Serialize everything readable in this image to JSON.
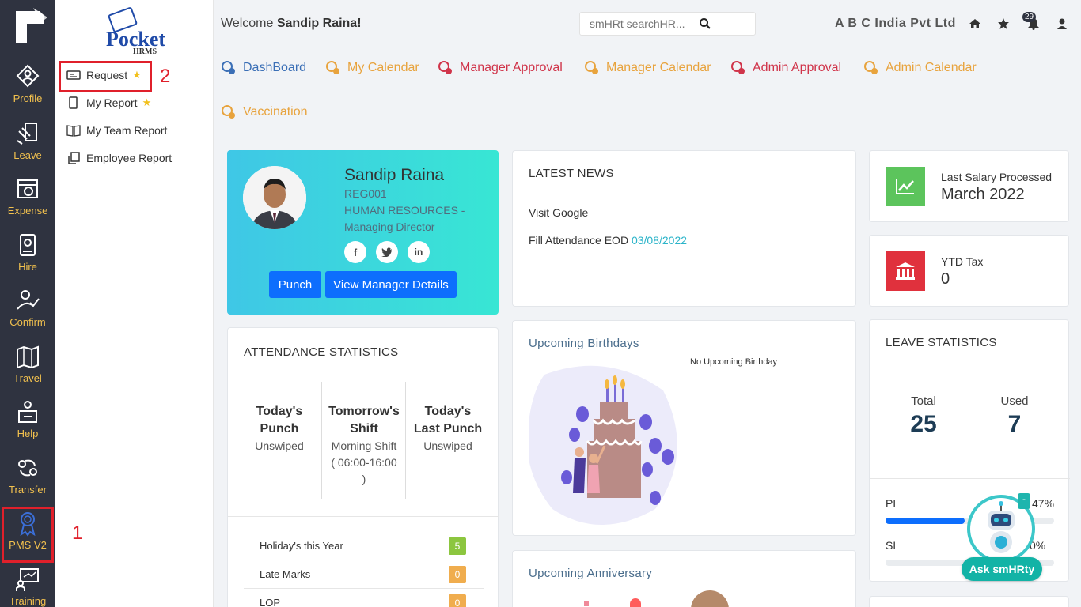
{
  "rail": {
    "items": [
      {
        "label": "Profile"
      },
      {
        "label": "Leave"
      },
      {
        "label": "Expense"
      },
      {
        "label": "Hire"
      },
      {
        "label": "Confirm"
      },
      {
        "label": "Travel"
      },
      {
        "label": "Help"
      },
      {
        "label": "Transfer"
      },
      {
        "label": "PMS V2"
      },
      {
        "label": "Training"
      }
    ],
    "accent_color": "#f2c14e"
  },
  "brand": {
    "logo_text": "Pocket",
    "logo_sub": "HRMS"
  },
  "submenu": {
    "items": [
      {
        "label": "Request",
        "starred": true
      },
      {
        "label": "My Report",
        "starred": true
      },
      {
        "label": "My Team Report",
        "starred": false
      },
      {
        "label": "Employee Report",
        "starred": false
      }
    ]
  },
  "annotations": {
    "one": "1",
    "two": "2"
  },
  "header": {
    "welcome_prefix": "Welcome",
    "user_name": "Sandip Raina!",
    "search_placeholder": "smHRt searchHR...",
    "company": "A B C India Pvt Ltd",
    "notification_count": "29"
  },
  "tabs": [
    {
      "label": "DashBoard",
      "color": "#3b6fb6"
    },
    {
      "label": "My Calendar",
      "color": "#e8a33d"
    },
    {
      "label": "Manager Approval",
      "color": "#d0344a"
    },
    {
      "label": "Manager Calendar",
      "color": "#e8a33d"
    },
    {
      "label": "Admin Approval",
      "color": "#d0344a"
    },
    {
      "label": "Admin Calendar",
      "color": "#e8a33d"
    },
    {
      "label": "Vaccination",
      "color": "#e8a33d"
    }
  ],
  "profile": {
    "name": "Sandip Raina",
    "code": "REG001",
    "department": "HUMAN RESOURCES -",
    "designation": "Managing Director",
    "punch_label": "Punch",
    "manager_label": "View Manager Details"
  },
  "news": {
    "title": "LATEST NEWS",
    "item1": "Visit Google",
    "item2_text": "Fill Attendance EOD",
    "item2_date": "03/08/2022"
  },
  "salary": {
    "label": "Last Salary Processed",
    "value": "March 2022"
  },
  "tax": {
    "label": "YTD Tax",
    "value": "0"
  },
  "attendance": {
    "title": "ATTENDANCE STATISTICS",
    "col1_h1": "Today's",
    "col1_h2": "Punch",
    "col1_v": "Unswiped",
    "col2_h1": "Tomorrow's",
    "col2_h2": "Shift",
    "col2_v1": "Morning Shift",
    "col2_v2": "( 06:00-16:00",
    "col2_v3": ")",
    "col3_h1": "Today's",
    "col3_h2": "Last Punch",
    "col3_v": "Unswiped",
    "rows": [
      {
        "label": "Holiday's this Year",
        "value": "5",
        "color": "#8cc63f"
      },
      {
        "label": "Late Marks",
        "value": "0",
        "color": "#f0ad4e"
      },
      {
        "label": "LOP",
        "value": "0",
        "color": "#f0ad4e"
      }
    ]
  },
  "birthdays": {
    "title": "Upcoming Birthdays",
    "empty": "No Upcoming Birthday"
  },
  "anniversary": {
    "title": "Upcoming Anniversary"
  },
  "leave": {
    "title": "LEAVE STATISTICS",
    "total_label": "Total",
    "total": "25",
    "used_label": "Used",
    "used": "7",
    "bars": [
      {
        "label": "PL",
        "percent_text": "47%",
        "percent": 0.47
      },
      {
        "label": "SL",
        "percent_text": "0%",
        "percent": 0
      }
    ]
  },
  "bot": {
    "label": "Ask smHRty",
    "minimize": "-"
  }
}
